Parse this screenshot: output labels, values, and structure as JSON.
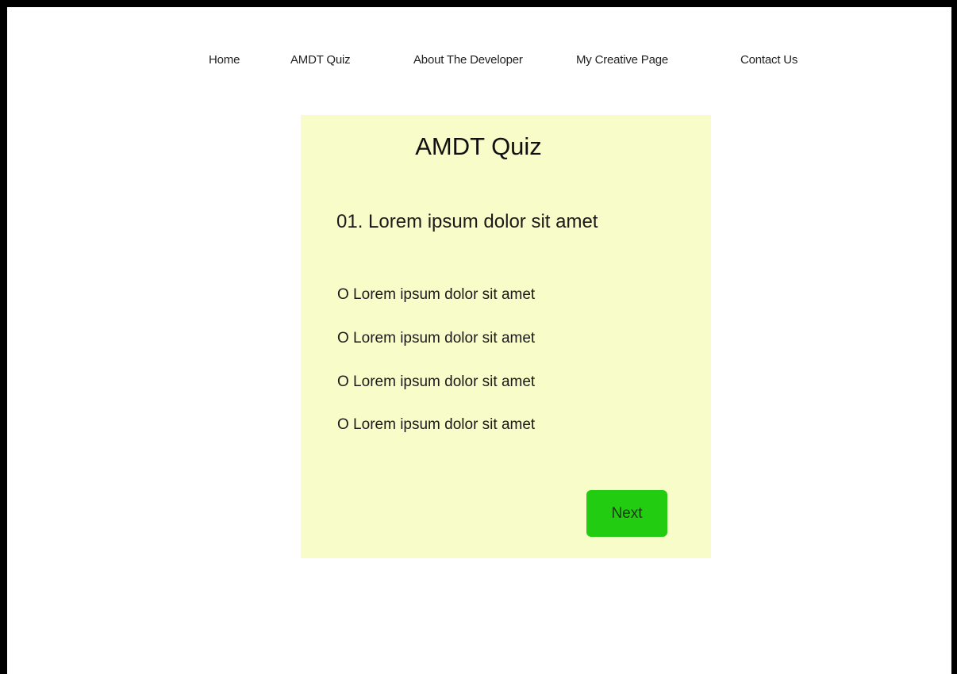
{
  "nav": {
    "items": [
      {
        "label": "Home"
      },
      {
        "label": "AMDT Quiz"
      },
      {
        "label": "About The Developer"
      },
      {
        "label": "My Creative Page"
      },
      {
        "label": "Contact Us"
      }
    ]
  },
  "quiz": {
    "title": "AMDT Quiz",
    "question": "01. Lorem ipsum dolor sit amet",
    "options": [
      {
        "label": "O Lorem ipsum dolor sit amet"
      },
      {
        "label": "O Lorem ipsum dolor sit amet"
      },
      {
        "label": "O Lorem ipsum dolor sit amet"
      },
      {
        "label": "O Lorem ipsum dolor sit amet"
      }
    ],
    "next_label": "Next"
  },
  "colors": {
    "card_background": "#f8fcc8",
    "button_green": "#22cc11",
    "frame_border": "#000000"
  }
}
